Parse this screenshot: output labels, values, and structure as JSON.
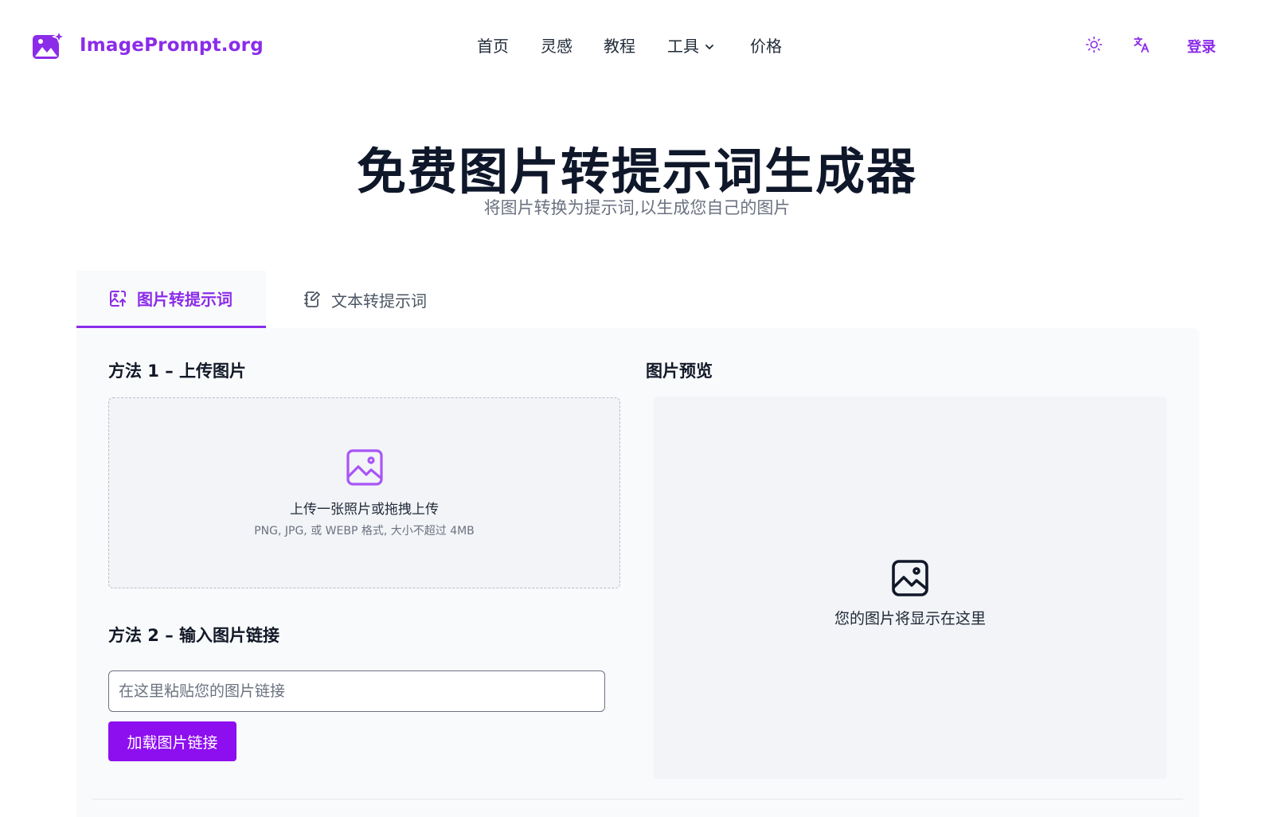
{
  "header": {
    "logo_text": "ImagePrompt.org",
    "nav": [
      {
        "label": "首页"
      },
      {
        "label": "灵感"
      },
      {
        "label": "教程"
      },
      {
        "label": "工具",
        "has_dropdown": true
      },
      {
        "label": "价格"
      }
    ],
    "theme_icon": "sun-icon",
    "language_icon": "translate-icon",
    "login_label": "登录"
  },
  "hero": {
    "title": "免费图片转提示词生成器",
    "subtitle": "将图片转换为提示词,以生成您自己的图片"
  },
  "tabs": [
    {
      "label": "图片转提示词",
      "icon": "image-upload-icon",
      "active": true
    },
    {
      "label": "文本转提示词",
      "icon": "notebook-edit-icon",
      "active": false
    }
  ],
  "method1": {
    "title": "方法 1 – 上传图片",
    "dropzone_text": "上传一张照片或拖拽上传",
    "dropzone_hint": "PNG, JPG, 或 WEBP 格式, 大小不超过 4MB"
  },
  "method2": {
    "title": "方法 2 – 输入图片链接",
    "placeholder": "在这里粘贴您的图片链接",
    "value": "",
    "button_label": "加载图片链接"
  },
  "preview": {
    "title": "图片预览",
    "placeholder_text": "您的图片将显示在这里"
  },
  "colors": {
    "accent": "#8b2ce9",
    "button": "#8d0ff0",
    "panel_bg": "#f9fafb"
  }
}
